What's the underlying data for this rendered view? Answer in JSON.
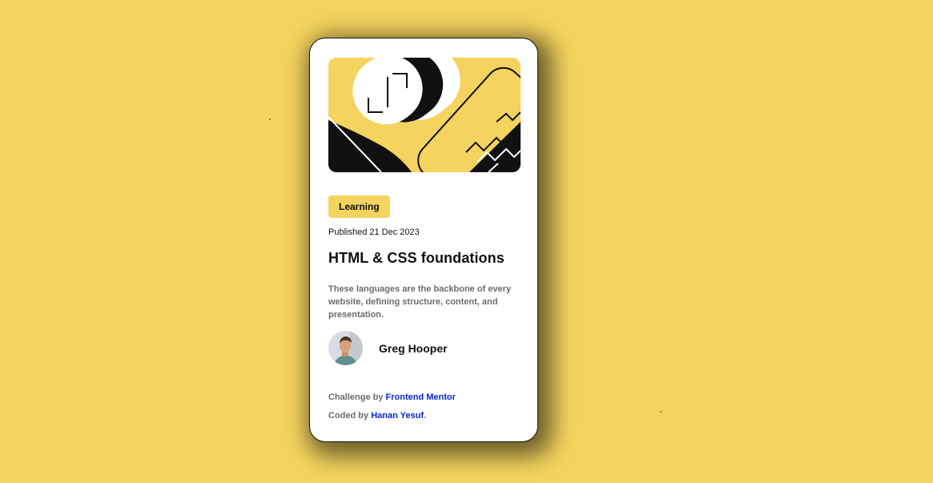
{
  "colors": {
    "background": "#f4d35e",
    "card": "#ffffff",
    "text": "#111111",
    "muted": "#6b6b6b",
    "link": "#0b26d6"
  },
  "card": {
    "category": "Learning",
    "published": "Published 21 Dec 2023",
    "title": "HTML & CSS foundations",
    "description": "These languages are the backbone of every website, defining structure, content, and presentation."
  },
  "author": {
    "name": "Greg Hooper"
  },
  "attribution": {
    "challenge_prefix": "Challenge by",
    "challenge_link": "Frontend Mentor",
    "coded_prefix": "Coded by",
    "coded_link": "Hanan Yesuf",
    "coded_suffix": "."
  },
  "icons": {
    "hero": "abstract-illustration",
    "avatar": "user-photo"
  }
}
